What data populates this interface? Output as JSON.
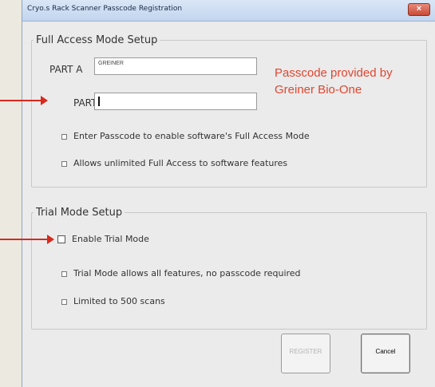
{
  "window": {
    "title": "Cryo.s Rack Scanner Passcode Registration",
    "close_glyph": "×"
  },
  "full_access": {
    "legend": "Full Access Mode Setup",
    "part_a_label": "PART A",
    "part_a_value": "GREINER",
    "part_b_label": "PART B",
    "part_b_value": "",
    "bullets": [
      "Enter Passcode to enable software's Full Access Mode",
      "Allows unlimited Full Access to software features"
    ]
  },
  "trial": {
    "legend": "Trial Mode Setup",
    "enable_label": "Enable Trial Mode",
    "enable_checked": false,
    "bullets": [
      "Trial Mode allows all features, no passcode required",
      "Limited to 500 scans"
    ]
  },
  "buttons": {
    "register": "REGISTER",
    "cancel": "Cancel"
  },
  "annotation": {
    "line1": "Passcode provided by",
    "line2": "Greiner Bio-One",
    "color": "#e0462f"
  }
}
